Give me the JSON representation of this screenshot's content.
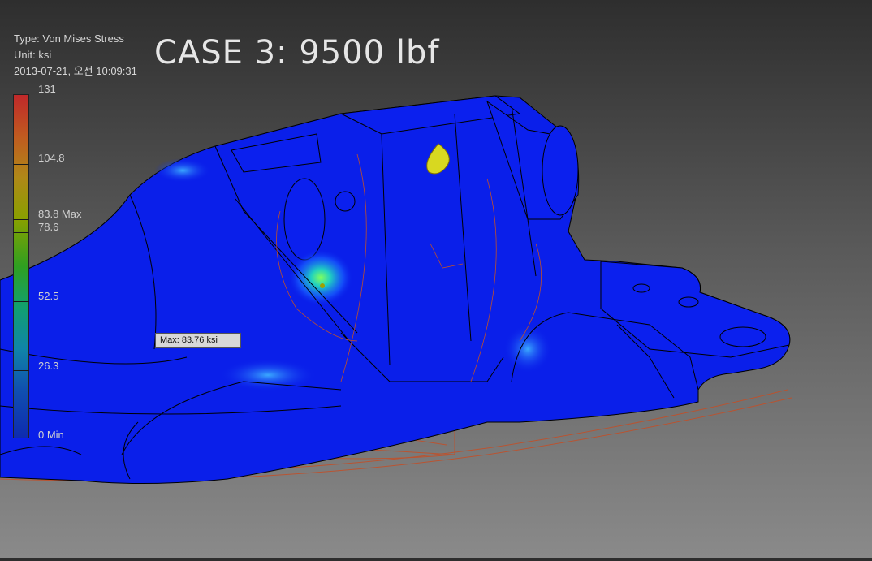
{
  "result_info": {
    "type_line": "Type: Von Mises Stress",
    "unit_line": "Unit: ksi",
    "timestamp": "2013-07-21, 오전 10:09:31"
  },
  "title": "CASE 3: 9500 lbf",
  "legend": {
    "labels": [
      "131",
      "104.8",
      "83.8 Max",
      "78.6",
      "52.5",
      "26.3",
      "0 Min"
    ],
    "colors": {
      "high": "#c0282a",
      "mid": "#2fa020",
      "low": "#0e2bb0"
    }
  },
  "callout": {
    "text": "Max: 83.76 ksi"
  },
  "colors": {
    "part": "#0a1fea",
    "edges": "#000000",
    "hidden_lines": "#c0502a",
    "probe": "#d8d820"
  }
}
